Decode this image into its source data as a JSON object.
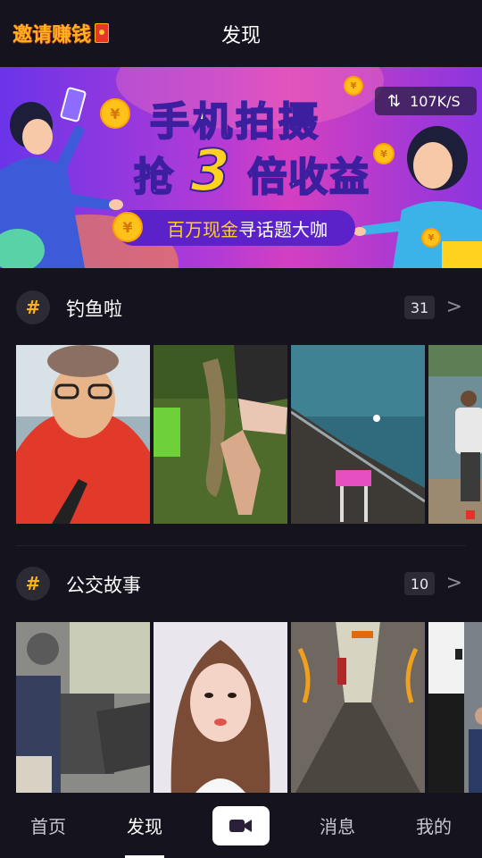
{
  "header": {
    "invite_label": "邀请赚钱",
    "title": "发现"
  },
  "banner": {
    "headline_line1": "手机拍摄",
    "headline_line2_prefix": "抢",
    "headline_number": "3",
    "headline_line2_suffix": "倍收益",
    "sub_highlight": "百万现金",
    "sub_rest": "寻话题大咖",
    "speed": "107K/S",
    "colors": {
      "bg_start": "#6a34e9",
      "bg_mid": "#d43fc0",
      "coin": "#ffc21a",
      "pill": "#5a22c8"
    }
  },
  "topics": [
    {
      "hash": "#",
      "title": "钓鱼啦",
      "count": "31",
      "chevron": "chevron-right-icon",
      "thumbs": [
        "man-red-hoodie-selfie",
        "holding-fish-in-grass",
        "lake-water-shore",
        "man-fishing-by-water"
      ]
    },
    {
      "hash": "#",
      "title": "公交故事",
      "count": "10",
      "chevron": "chevron-right-icon",
      "thumbs": [
        "bus-passengers-seats",
        "woman-selfie-white-top",
        "bus-aisle-orange-rails",
        "man-standing-on-bus"
      ]
    }
  ],
  "tabbar": {
    "home": "首页",
    "discover": "发现",
    "camera_icon": "video-camera-icon",
    "messages": "消息",
    "me": "我的",
    "active": "discover"
  }
}
